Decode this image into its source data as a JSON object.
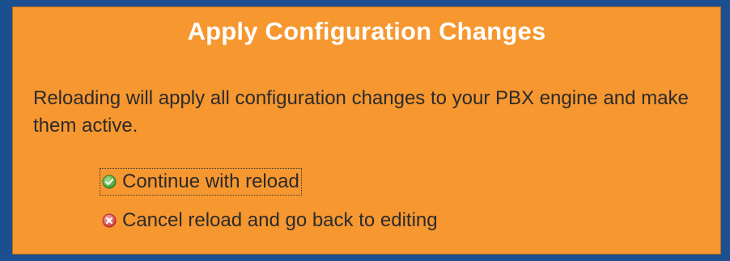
{
  "dialog": {
    "title": "Apply Configuration Changes",
    "message": "Reloading will apply all configuration changes to your PBX engine and make them active.",
    "options": [
      {
        "label": "Continue with reload",
        "icon": "check-circle-icon",
        "color": "#46a23a"
      },
      {
        "label": "Cancel reload and go back to editing",
        "icon": "cancel-circle-icon",
        "color": "#d9534f"
      }
    ]
  },
  "colors": {
    "background": "#1c4f8f",
    "panel": "#f7972f",
    "title_text": "#ffffff",
    "body_text": "#2b2b2b"
  }
}
